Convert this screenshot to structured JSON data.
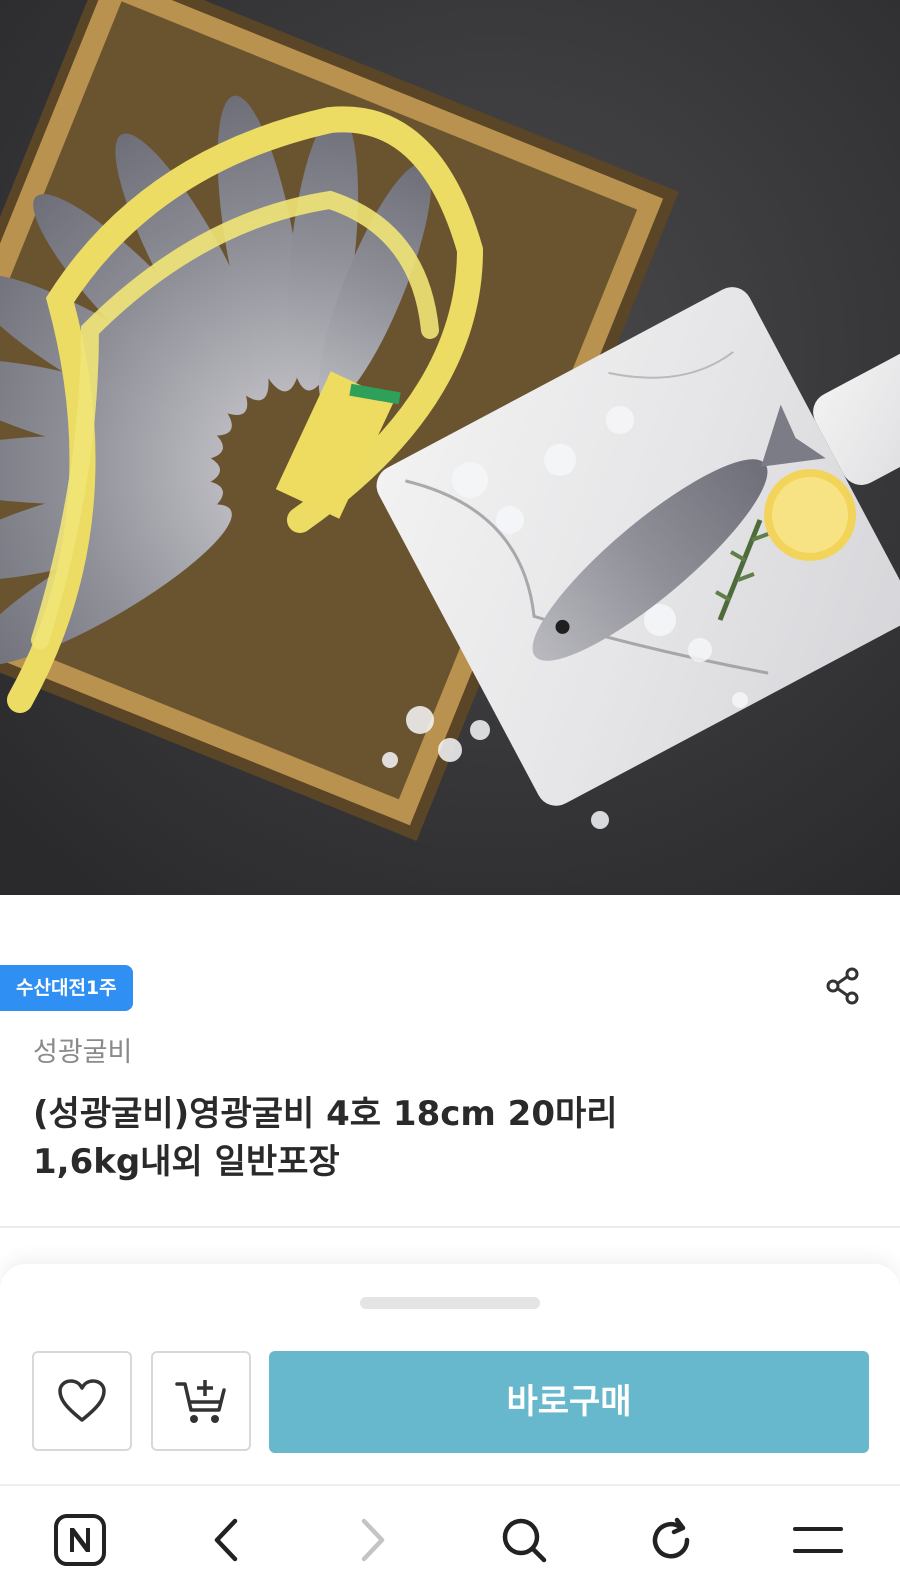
{
  "product": {
    "badge": "수산대전1주",
    "brand": "성광굴비",
    "title_line1": "(성광굴비)영광굴비 4호 18cm 20마리",
    "title_line2": "1,6kg내외 일반포장",
    "image_alt": "product-photo"
  },
  "actions": {
    "buy_label": "바로구매",
    "like_icon": "heart-icon",
    "cart_icon": "cart-add-icon",
    "share_icon": "share-icon"
  },
  "browser_toolbar": {
    "items": [
      "naver-home-icon",
      "back-icon",
      "forward-icon",
      "search-icon",
      "reload-icon",
      "menu-icon"
    ]
  },
  "colors": {
    "badge": "#2f8ff3",
    "buy_button": "#67b8cc",
    "brand_text": "#8a8a8a"
  }
}
